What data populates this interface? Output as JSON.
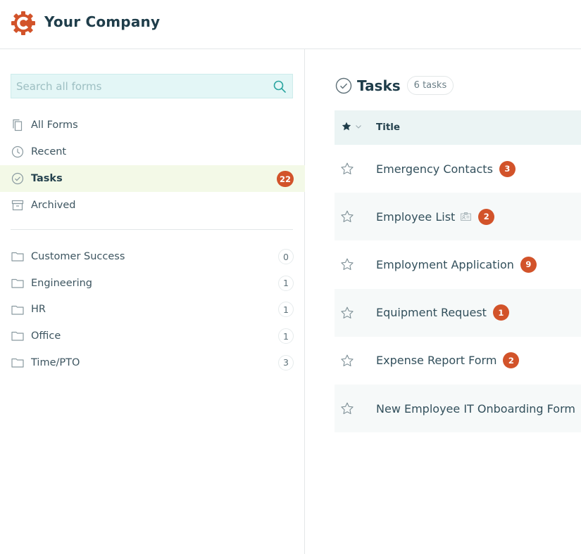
{
  "header": {
    "company_name": "Your Company",
    "logo_icon": "gear-c-logo-icon",
    "brand_color": "#d2532a"
  },
  "sidebar": {
    "search": {
      "placeholder": "Search all forms",
      "value": "",
      "icon": "search-icon"
    },
    "nav_items": [
      {
        "label": "All Forms",
        "icon": "copy-icon",
        "active": false
      },
      {
        "label": "Recent",
        "icon": "clock-icon",
        "active": false
      },
      {
        "label": "Tasks",
        "icon": "check-circle-icon",
        "active": true,
        "badge": "22"
      },
      {
        "label": "Archived",
        "icon": "archive-icon",
        "active": false
      }
    ],
    "folders": [
      {
        "label": "Customer Success",
        "count": "0"
      },
      {
        "label": "Engineering",
        "count": "1"
      },
      {
        "label": "HR",
        "count": "1"
      },
      {
        "label": "Office",
        "count": "1"
      },
      {
        "label": "Time/PTO",
        "count": "3"
      }
    ]
  },
  "main": {
    "title": "Tasks",
    "count_label": "6 tasks",
    "table": {
      "columns": [
        "Title"
      ],
      "rows": [
        {
          "title": "Emergency Contacts",
          "badge": "3",
          "card_icon": false
        },
        {
          "title": "Employee List",
          "badge": "2",
          "card_icon": true
        },
        {
          "title": "Employment Application",
          "badge": "9",
          "card_icon": false
        },
        {
          "title": "Equipment Request",
          "badge": "1",
          "card_icon": false
        },
        {
          "title": "Expense Report Form",
          "badge": "2",
          "card_icon": false
        },
        {
          "title": "New Employee IT Onboarding Form",
          "badge": "",
          "card_icon": false
        }
      ]
    }
  }
}
